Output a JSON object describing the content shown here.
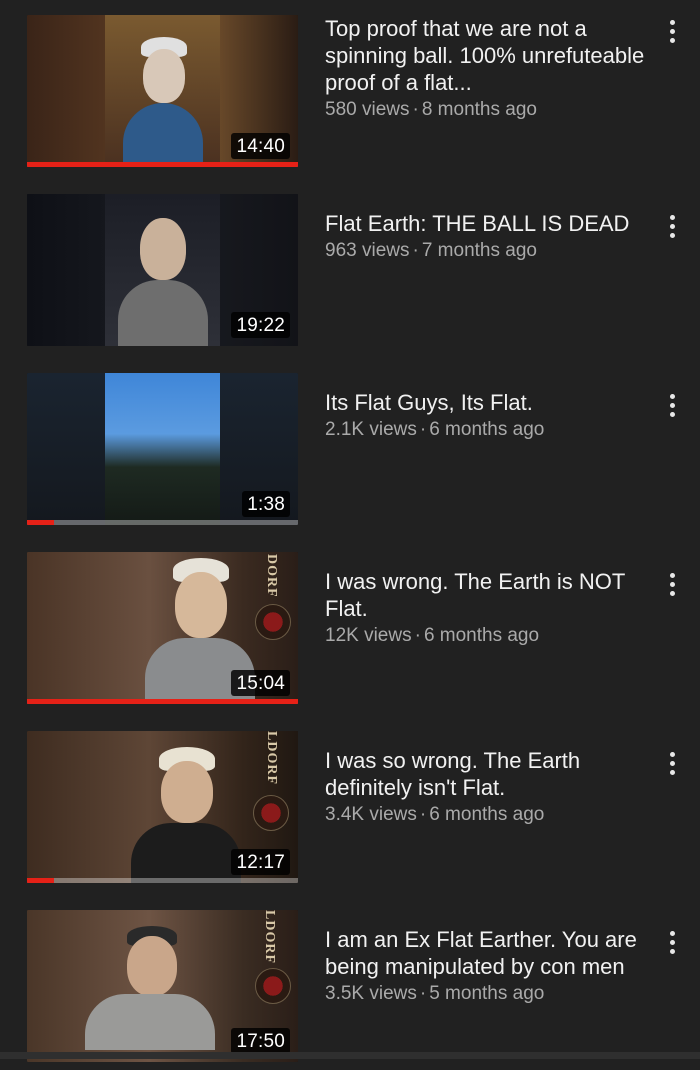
{
  "videos": [
    {
      "title": "Top proof that we are not a spinning ball. 100% unrefuteable proof of a flat...",
      "views": "580 views",
      "age": "8 months ago",
      "duration": "14:40",
      "watched_fraction": 1.0,
      "thumbnail_icon": "man-in-cap-thumbnail"
    },
    {
      "title": "Flat Earth: THE BALL IS DEAD",
      "views": "963 views",
      "age": "7 months ago",
      "duration": "19:22",
      "watched_fraction": 0,
      "thumbnail_icon": "bald-man-thumbnail"
    },
    {
      "title": "Its Flat Guys, Its Flat.",
      "views": "2.1K views",
      "age": "6 months ago",
      "duration": "1:38",
      "watched_fraction": 0.1,
      "thumbnail_icon": "evening-sky-thumbnail"
    },
    {
      "title": "I was wrong. The Earth is NOT Flat.",
      "views": "12K views",
      "age": "6 months ago",
      "duration": "15:04",
      "watched_fraction": 1.0,
      "thumbnail_icon": "man-in-cap-garage-thumbnail",
      "banner_text": "DORF"
    },
    {
      "title": "I was so wrong. The Earth definitely isn't Flat.",
      "views": "3.4K views",
      "age": "6 months ago",
      "duration": "12:17",
      "watched_fraction": 0.1,
      "thumbnail_icon": "man-in-cap-garage-thumbnail",
      "banner_text": "LDORF"
    },
    {
      "title": "I am an Ex Flat Earther. You are being manipulated by con men",
      "views": "3.5K views",
      "age": "5 months ago",
      "duration": "17:50",
      "watched_fraction": 0,
      "thumbnail_icon": "man-in-hoodie-garage-thumbnail",
      "banner_text": "LDORF"
    }
  ],
  "separator": "·",
  "menu_icon": "more-vert-icon",
  "colors": {
    "background": "#212121",
    "title": "#f1f1f1",
    "meta": "#aaaaaa",
    "progress": "#e62117"
  }
}
